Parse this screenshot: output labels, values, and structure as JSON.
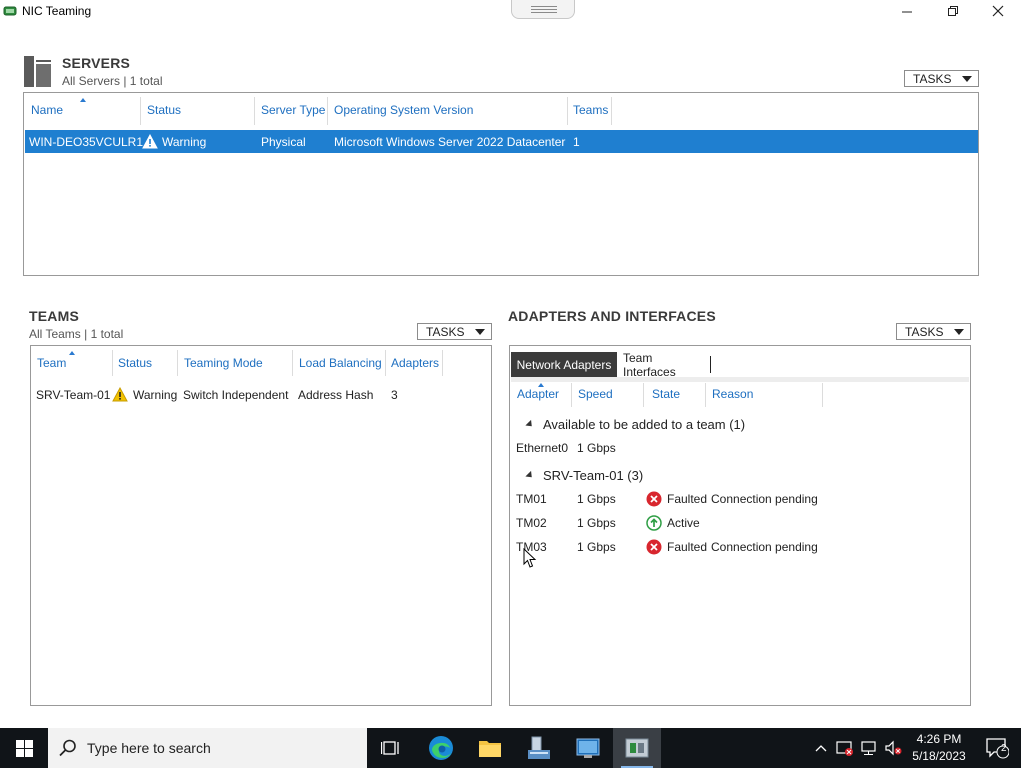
{
  "window": {
    "title": "NIC Teaming"
  },
  "servers": {
    "title": "SERVERS",
    "subtitle": "All Servers | 1 total",
    "tasks_label": "TASKS",
    "columns": [
      "Name",
      "Status",
      "Server Type",
      "Operating System Version",
      "Teams"
    ],
    "rows": [
      {
        "name": "WIN-DEO35VCULR1",
        "status": "Warning",
        "type": "Physical",
        "os": "Microsoft Windows Server 2022 Datacenter",
        "teams": "1"
      }
    ]
  },
  "teams": {
    "title": "TEAMS",
    "subtitle": "All Teams | 1 total",
    "tasks_label": "TASKS",
    "columns": [
      "Team",
      "Status",
      "Teaming Mode",
      "Load Balancing",
      "Adapters"
    ],
    "rows": [
      {
        "team": "SRV-Team-01",
        "status": "Warning",
        "mode": "Switch Independent",
        "lb": "Address Hash",
        "adapters": "3"
      }
    ]
  },
  "adapters": {
    "title": "ADAPTERS AND INTERFACES",
    "tasks_label": "TASKS",
    "tabs": [
      "Network Adapters",
      "Team Interfaces"
    ],
    "columns": [
      "Adapter",
      "Speed",
      "State",
      "Reason"
    ],
    "groups": [
      {
        "label": "Available to be added to a team (1)",
        "rows": [
          {
            "adapter": "Ethernet0",
            "speed": "1 Gbps",
            "state": "",
            "reason": "",
            "icon": "none"
          }
        ]
      },
      {
        "label": "SRV-Team-01 (3)",
        "rows": [
          {
            "adapter": "TM01",
            "speed": "1 Gbps",
            "state": "Faulted",
            "reason": "Connection pending",
            "icon": "error-icon"
          },
          {
            "adapter": "TM02",
            "speed": "1 Gbps",
            "state": "Active",
            "reason": "",
            "icon": "active-icon"
          },
          {
            "adapter": "TM03",
            "speed": "1 Gbps",
            "state": "Faulted",
            "reason": "Connection pending",
            "icon": "error-icon"
          }
        ]
      }
    ]
  },
  "taskbar": {
    "search_placeholder": "Type here to search",
    "time": "4:26 PM",
    "date": "5/18/2023",
    "notification_count": "2"
  },
  "colors": {
    "accent": "#1f7fd0",
    "link": "#1e6fc0",
    "error": "#d8262e",
    "active": "#2e9e44",
    "warning": "#f2c200"
  }
}
